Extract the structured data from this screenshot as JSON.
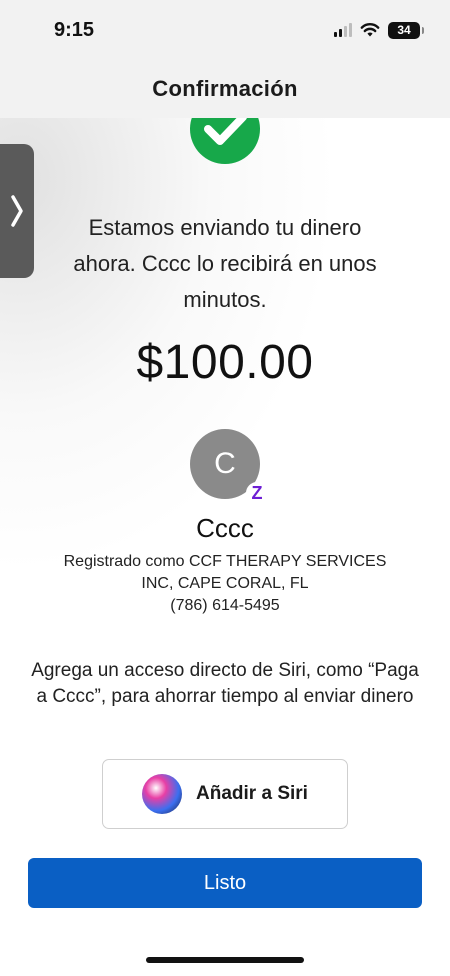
{
  "status_bar": {
    "time": "9:15",
    "battery": "34",
    "icons": [
      "signal-icon",
      "wifi-icon",
      "battery-icon"
    ]
  },
  "nav": {
    "title": "Confirmación"
  },
  "side_tab": {
    "icon": "chevron-right-icon"
  },
  "confirmation": {
    "icon": "checkmark-icon",
    "message": "Estamos enviando tu dinero ahora. Cccc lo recibirá en unos minutos.",
    "amount": "$100.00"
  },
  "recipient": {
    "initial": "C",
    "badge": "Z",
    "name": "Cccc",
    "registered_line1": "Registrado como CCF THERAPY SERVICES",
    "registered_line2": "INC, CAPE CORAL, FL",
    "phone": "(786) 614-5495"
  },
  "siri": {
    "prompt": "Agrega un acceso directo de Siri, como “Paga a Cccc”, para ahorrar tiempo al enviar dinero",
    "button_label": "Añadir a Siri"
  },
  "done_button": {
    "label": "Listo"
  },
  "colors": {
    "success": "#17a84a",
    "primary": "#0a5fc4",
    "zelle": "#6d1ed4",
    "avatar": "#8a8a8a"
  }
}
